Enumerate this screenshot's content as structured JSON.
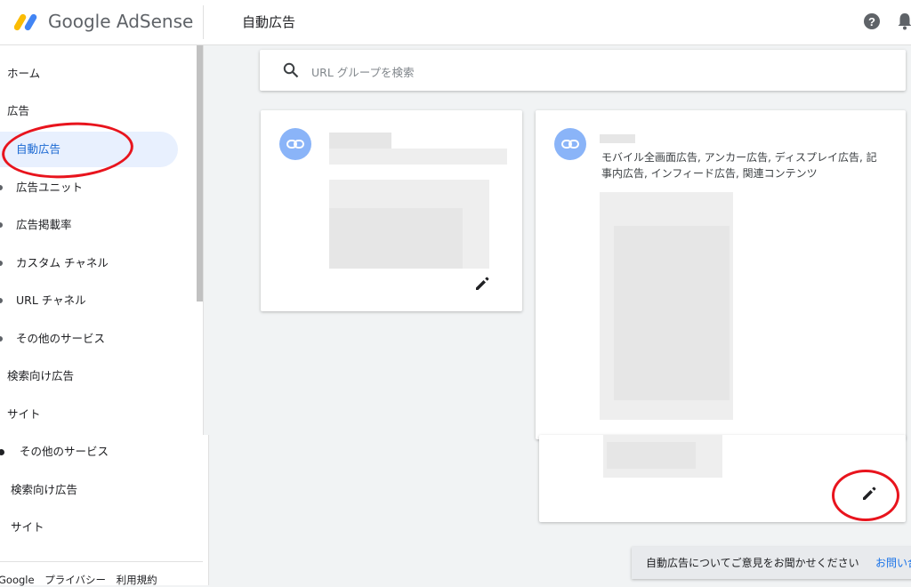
{
  "header": {
    "brand": "Google AdSense",
    "page_title": "自動広告",
    "logo_colors": [
      "#fbbc04",
      "#4285f4"
    ]
  },
  "sidebar": {
    "items": [
      {
        "label": "ホーム",
        "level": 0
      },
      {
        "label": "広告",
        "level": 0
      },
      {
        "label": "自動広告",
        "level": 1,
        "active": true
      },
      {
        "label": "広告ユニット",
        "level": 1
      },
      {
        "label": "広告掲載率",
        "level": 1
      },
      {
        "label": "カスタム チャネル",
        "level": 1
      },
      {
        "label": "URL チャネル",
        "level": 1
      },
      {
        "label": "その他のサービス",
        "level": 1
      },
      {
        "label": "検索向け広告",
        "level": 0
      },
      {
        "label": "サイト",
        "level": 0
      }
    ],
    "repeated_items": [
      "その他のサービス",
      "検索向け広告",
      "サイト"
    ],
    "footer_links": [
      "Google",
      "プライバシー",
      "利用規約"
    ]
  },
  "search": {
    "placeholder": "URL グループを検索"
  },
  "cards": [
    {
      "name": "",
      "description": ""
    },
    {
      "name": "",
      "description": "モバイル全画面広告, アンカー広告, ディスプレイ広告, 記事内広告, インフィード広告, 関連コンテンツ"
    }
  ],
  "feedback": {
    "message": "自動広告についてご意見をお聞かせください",
    "link": "お問い合わせ"
  },
  "colors": {
    "accent": "#1a73e8",
    "active_bg": "#e8f0fe",
    "annotation": "#e8141d",
    "link_icon_bg": "#8ab4f8"
  }
}
